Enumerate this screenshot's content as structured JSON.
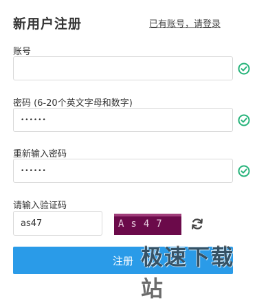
{
  "header": {
    "title": "新用户注册",
    "login_link": "已有账号，请登录"
  },
  "form": {
    "account": {
      "label": "账号",
      "value": "",
      "valid": true
    },
    "password": {
      "label": "密码 (6-20个英文字母和数字)",
      "value": "••••••",
      "valid": true
    },
    "confirm_password": {
      "label": "重新输入密码",
      "value": "••••••",
      "valid": true
    },
    "captcha": {
      "label": "请输入验证码",
      "value": "as47",
      "image_text": "As47"
    }
  },
  "submit_label": "注册",
  "watermark": "极速下载站",
  "colors": {
    "accent": "#2a9be8",
    "valid": "#26b37a",
    "captcha_bg": "#6b0a4a"
  },
  "icons": {
    "valid": "check-circle-icon",
    "refresh": "refresh-icon"
  }
}
